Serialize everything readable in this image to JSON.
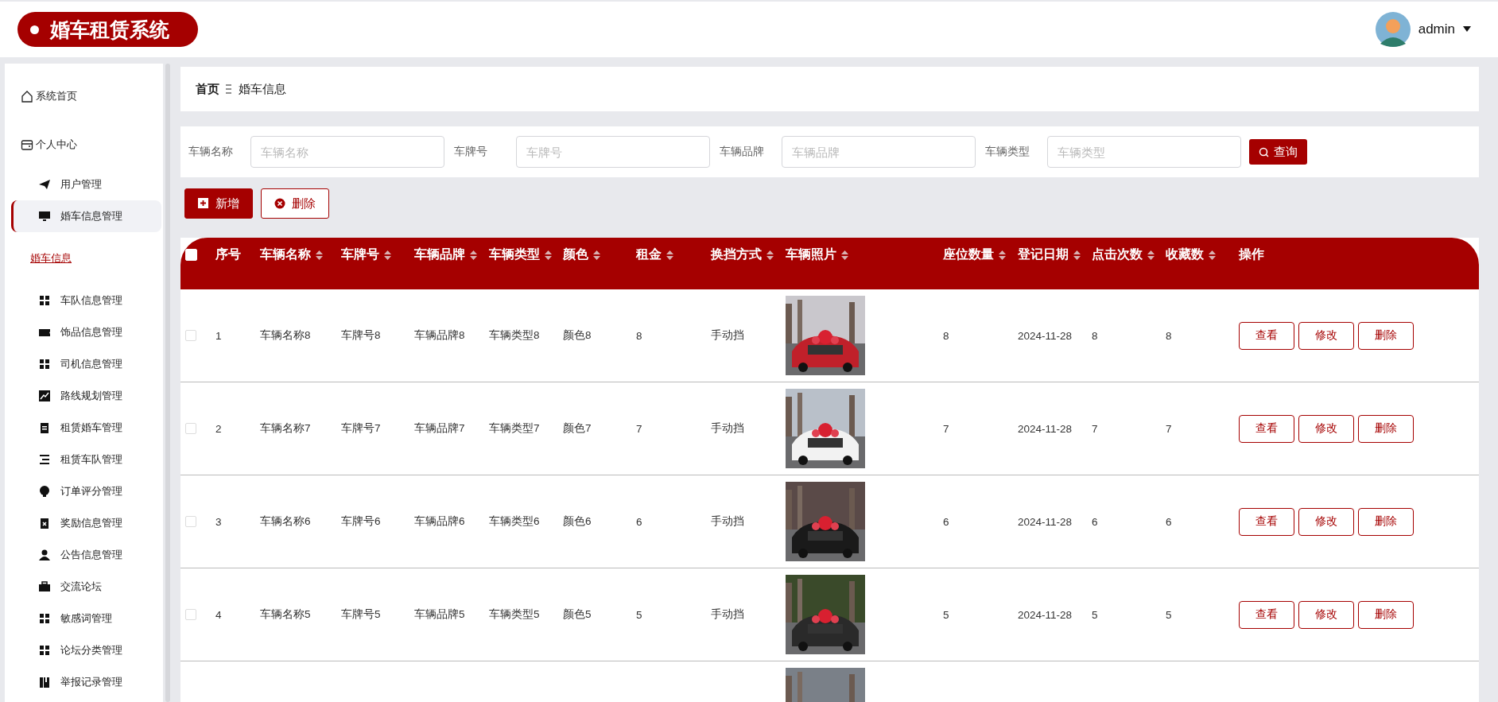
{
  "header": {
    "title": "婚车租赁系统",
    "user": "admin"
  },
  "sidebar": {
    "items": [
      {
        "label": "系统首页",
        "selected": false
      },
      {
        "label": "个人中心",
        "selected": false,
        "children": [
          {
            "label": "用户管理",
            "selected": false
          },
          {
            "label": "婚车信息管理",
            "selected": true,
            "children": [
              {
                "label": "婚车信息",
                "selected": true
              }
            ]
          },
          {
            "label": "车队信息管理",
            "selected": false
          },
          {
            "label": "饰品信息管理",
            "selected": false
          },
          {
            "label": "司机信息管理",
            "selected": false
          },
          {
            "label": "路线规划管理",
            "selected": false
          },
          {
            "label": "租赁婚车管理",
            "selected": false
          },
          {
            "label": "租赁车队管理",
            "selected": false
          },
          {
            "label": "订单评分管理",
            "selected": false
          },
          {
            "label": "奖励信息管理",
            "selected": false
          },
          {
            "label": "公告信息管理",
            "selected": false
          },
          {
            "label": "交流论坛",
            "selected": false
          },
          {
            "label": "敏感词管理",
            "selected": false
          },
          {
            "label": "论坛分类管理",
            "selected": false
          },
          {
            "label": "举报记录管理",
            "selected": false
          }
        ]
      }
    ]
  },
  "breadcrumb": [
    "首页",
    "婚车信息"
  ],
  "filters": [
    {
      "label": "车辆名称",
      "placeholder": "车辆名称"
    },
    {
      "label": "车牌号",
      "placeholder": "车牌号"
    },
    {
      "label": "车辆品牌",
      "placeholder": "车辆品牌"
    },
    {
      "label": "车辆类型",
      "placeholder": "车辆类型"
    }
  ],
  "search_button": "查询",
  "actions": [
    {
      "label": "新增",
      "kind": "add"
    },
    {
      "label": "删除",
      "kind": "delete"
    }
  ],
  "table": {
    "header_checked": false,
    "columns": [
      {
        "label": "序号",
        "kind": "plain"
      },
      {
        "label": "车辆名称",
        "kind": "sort"
      },
      {
        "label": "车牌号",
        "kind": "sort"
      },
      {
        "label": "车辆品牌",
        "kind": "sort"
      },
      {
        "label": "车辆类型",
        "kind": "sort"
      },
      {
        "label": "颜色",
        "kind": "sort"
      },
      {
        "label": "租金",
        "kind": "sort"
      },
      {
        "label": "换挡方式",
        "kind": "sort"
      },
      {
        "label": "车辆照片",
        "kind": "sort"
      },
      {
        "label": "座位数量",
        "kind": "sort"
      },
      {
        "label": "登记日期",
        "kind": "sort"
      },
      {
        "label": "点击次数",
        "kind": "sort"
      },
      {
        "label": "收藏数",
        "kind": "sort"
      },
      {
        "label": "操作",
        "kind": "plain"
      }
    ],
    "rows": [
      {
        "checked": false,
        "cells": [
          "1",
          "车辆名称8",
          "车牌号8",
          "车辆品牌8",
          "车辆类型8",
          "颜色8",
          "8",
          "手动挡",
          null,
          "8",
          "2024-11-28",
          "8",
          "8"
        ],
        "buttons": [
          "查看",
          "修改",
          "删除"
        ]
      },
      {
        "checked": false,
        "cells": [
          "2",
          "车辆名称7",
          "车牌号7",
          "车辆品牌7",
          "车辆类型7",
          "颜色7",
          "7",
          "手动挡",
          null,
          "7",
          "2024-11-28",
          "7",
          "7"
        ],
        "buttons": [
          "查看",
          "修改",
          "删除"
        ]
      },
      {
        "checked": false,
        "cells": [
          "3",
          "车辆名称6",
          "车牌号6",
          "车辆品牌6",
          "车辆类型6",
          "颜色6",
          "6",
          "手动挡",
          null,
          "6",
          "2024-11-28",
          "6",
          "6"
        ],
        "buttons": [
          "查看",
          "修改",
          "删除"
        ]
      },
      {
        "checked": false,
        "cells": [
          "4",
          "车辆名称5",
          "车牌号5",
          "车辆品牌5",
          "车辆类型5",
          "颜色5",
          "5",
          "手动挡",
          null,
          "5",
          "2024-11-28",
          "5",
          "5"
        ],
        "buttons": [
          "查看",
          "修改",
          "删除"
        ]
      },
      {
        "cells": [
          null,
          null,
          null,
          null,
          null,
          null,
          null,
          null,
          null,
          null,
          null,
          null,
          null
        ],
        "buttons": []
      }
    ]
  }
}
